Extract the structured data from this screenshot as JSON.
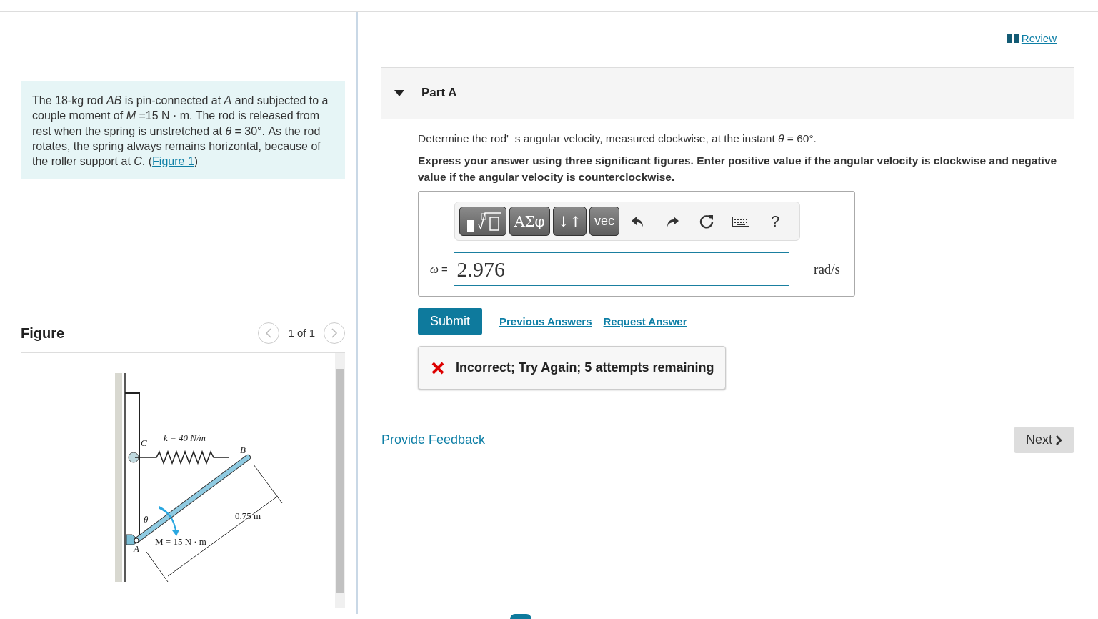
{
  "review_link": "Review",
  "problem": {
    "text": "The 18-kg rod *AB* is pin-connected at *A* and subjected to a couple moment of *M* =15 N · m. The rod is released from rest when the spring is unstretched at *θ* = 30°. As the rod rotates, the spring always remains horizontal, because of the roller support at *C*. (",
    "link": "Figure 1",
    "after": ")"
  },
  "figure": {
    "title": "Figure",
    "pager": "1 of 1",
    "prev_disabled": true,
    "next_disabled": true,
    "labels": [
      {
        "kind": "spring",
        "text": "k = 40 N/m"
      },
      {
        "kind": "c",
        "text": "C"
      },
      {
        "kind": "b",
        "text": "B"
      },
      {
        "kind": "theta",
        "text": "θ"
      },
      {
        "kind": "length",
        "text": "0.75 m"
      },
      {
        "kind": "moment",
        "text": "M = 15 N · m"
      },
      {
        "kind": "a",
        "text": "A"
      }
    ]
  },
  "part": {
    "title": "Part A",
    "expanded": true,
    "question": "Determine the rod'_s angular velocity, measured clockwise, at the instant *θ* = 60°.",
    "instruction": "Express your answer using three significant figures. Enter positive value if the angular velocity is clockwise and negative value if the angular velocity is counterclockwise.",
    "toolbar": [
      {
        "kind": "template"
      },
      {
        "kind": "text",
        "text": "ΑΣφ"
      },
      {
        "kind": "text",
        "text": "↓↑"
      },
      {
        "kind": "text",
        "text": "vec"
      },
      {
        "kind": "undo"
      },
      {
        "kind": "redo"
      },
      {
        "kind": "reset"
      },
      {
        "kind": "keyboard"
      },
      {
        "kind": "help",
        "text": "?"
      }
    ],
    "answer": {
      "label": "ω =",
      "value": "2.976",
      "unit": "rad/s"
    },
    "submit": "Submit",
    "links": [
      "Previous Answers",
      "Request Answer"
    ],
    "feedback": {
      "correct": false,
      "text": "Incorrect; Try Again; 5 attempts remaining"
    }
  },
  "provide_feedback": "Provide Feedback",
  "next_button": "Next"
}
